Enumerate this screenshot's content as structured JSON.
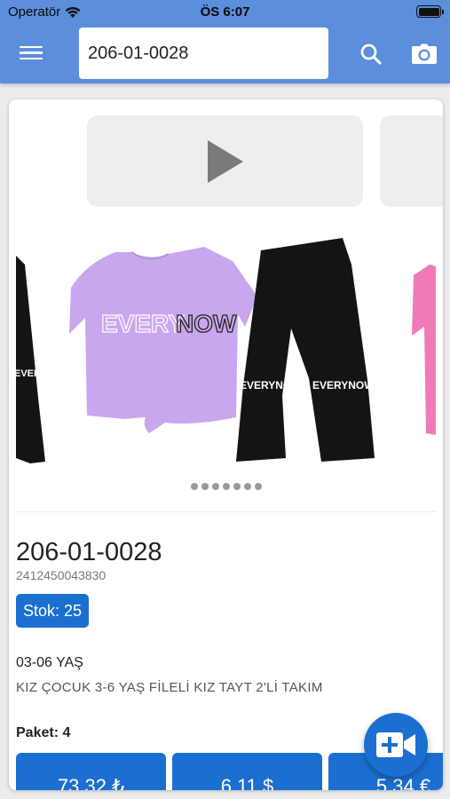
{
  "status_bar": {
    "carrier": "Operatör",
    "time": "ÖS 6:07"
  },
  "search": {
    "value": "206-01-0028"
  },
  "icons": {
    "menu": "menu-icon",
    "search": "search-icon",
    "camera": "camera-icon",
    "play": "play-icon",
    "video_add": "video-plus-icon"
  },
  "carousel": {
    "print_main": "EVERY",
    "print_accent": "NOW",
    "legging_label": "EVERYNOW",
    "dot_count": 7
  },
  "product": {
    "code": "206-01-0028",
    "barcode": "2412450043830",
    "stock": "Stok: 25",
    "age": "03-06 YAŞ",
    "description": "KIZ ÇOCUK 3-6 YAŞ FİLELİ KIZ TAYT 2'Lİ TAKIM",
    "package": "Paket: 4",
    "prices": [
      "73,32 ₺",
      "6,11 $",
      "5,34 €"
    ]
  },
  "colors": {
    "appbar": "#5b8fdc",
    "primary": "#1b6fd0",
    "shirt": "#c9a7ee",
    "legging": "#141414",
    "pink": "#f07ab8"
  }
}
